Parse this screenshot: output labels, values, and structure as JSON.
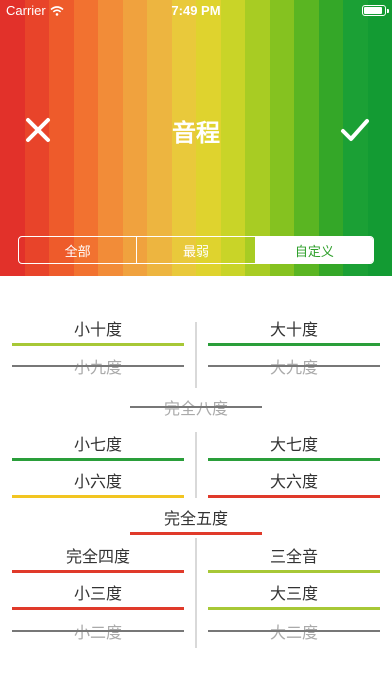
{
  "status_bar": {
    "carrier": "Carrier",
    "time": "7:49 PM"
  },
  "header": {
    "title": "音程",
    "stripe_colors": [
      "#e2312a",
      "#e8442a",
      "#ee5b2b",
      "#f27230",
      "#f28c38",
      "#f0a23e",
      "#edb540",
      "#e9c93b",
      "#dfd32e",
      "#c9d428",
      "#a8cc23",
      "#85c220",
      "#5ab522",
      "#34a728",
      "#1ba035",
      "#139b33"
    ],
    "close_icon": "close-icon",
    "confirm_icon": "checkmark-icon",
    "segments": [
      "全部",
      "最弱",
      "自定义"
    ],
    "selected_segment": 2
  },
  "intervals": {
    "minor_second_row": [
      {
        "label": "小十度",
        "color": "#a7c836",
        "enabled": true
      },
      {
        "label": "大十度",
        "color": "#2a9e3a",
        "enabled": true
      }
    ],
    "ninth_row": [
      {
        "label": "小九度",
        "color": "#7b7b7b",
        "enabled": false
      },
      {
        "label": "大九度",
        "color": "#7b7b7b",
        "enabled": false
      }
    ],
    "octave": {
      "label": "完全八度",
      "color": "#7b7b7b",
      "enabled": false
    },
    "seventh_row": [
      {
        "label": "小七度",
        "color": "#2a9e3a",
        "enabled": true
      },
      {
        "label": "大七度",
        "color": "#2a9e3a",
        "enabled": true
      }
    ],
    "sixth_row": [
      {
        "label": "小六度",
        "color": "#f2c521",
        "enabled": true
      },
      {
        "label": "大六度",
        "color": "#e03a2a",
        "enabled": true
      }
    ],
    "fifth": {
      "label": "完全五度",
      "color": "#e03a2a",
      "enabled": true
    },
    "fourth_row": [
      {
        "label": "完全四度",
        "color": "#e03a2a",
        "enabled": true
      },
      {
        "label": "三全音",
        "color": "#a7c836",
        "enabled": true
      }
    ],
    "third_row": [
      {
        "label": "小三度",
        "color": "#e03a2a",
        "enabled": true
      },
      {
        "label": "大三度",
        "color": "#a7c836",
        "enabled": true
      }
    ],
    "second_row": [
      {
        "label": "小二度",
        "color": "#7b7b7b",
        "enabled": false
      },
      {
        "label": "大二度",
        "color": "#7b7b7b",
        "enabled": false
      }
    ]
  }
}
